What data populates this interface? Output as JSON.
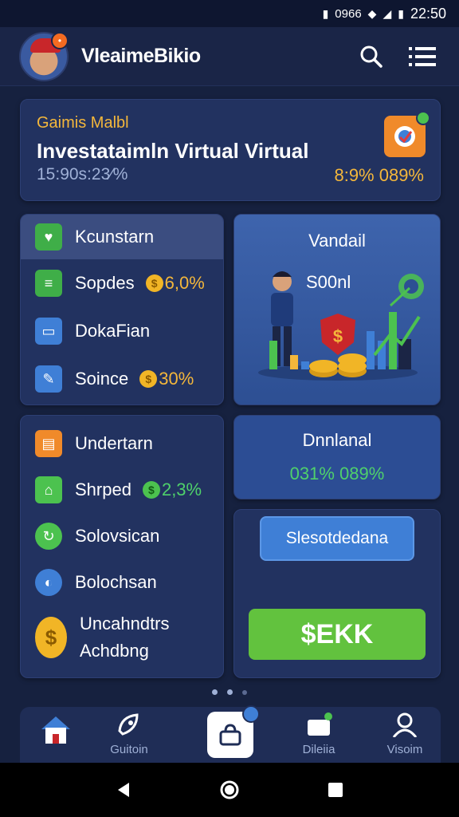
{
  "status_bar": {
    "network": "0966",
    "time": "22:50"
  },
  "header": {
    "title": "VleaimeBikio"
  },
  "hero": {
    "kicker": "Gaimis Malbl",
    "title": "Investataimln Virtual Virtual",
    "sub": "15:90s:23⁄%",
    "pct": "8:9% 089%"
  },
  "list1": {
    "items": [
      {
        "label": "Kcunstarn",
        "value": "",
        "icon": "heart-icon"
      },
      {
        "label": "Sopdes",
        "coin": "$",
        "value": "6,0%",
        "icon": "chart-icon"
      },
      {
        "label": "DokaFian",
        "coin": "",
        "value": "",
        "icon": "card-icon"
      },
      {
        "label": "Soince",
        "coin": "$",
        "value": "30%",
        "icon": "pen-icon"
      }
    ]
  },
  "illustration": {
    "title": "Vandail",
    "subtitle": "S00nl"
  },
  "list2": {
    "items": [
      {
        "label": "Undertarn",
        "icon": "clipboard-icon"
      },
      {
        "label": "Shrped",
        "coin": "$",
        "value": "2,3%",
        "icon": "store-icon"
      },
      {
        "label": "Solovsican",
        "icon": "refresh-icon"
      },
      {
        "label": "Bolochsan",
        "icon": "search-globe-icon"
      },
      {
        "label": "Uncahndtrs",
        "label2": "Achdbng",
        "icon": "dollar-coin-icon"
      }
    ]
  },
  "stat": {
    "title": "Dnnlanal",
    "value": "031% 089%"
  },
  "actions": {
    "blue_label": "Slesotdedana",
    "green_label": "$EKK"
  },
  "bottom_nav": {
    "items": [
      {
        "label": "",
        "icon": "home-icon"
      },
      {
        "label": "Guitoin",
        "icon": "rocket-icon"
      },
      {
        "label": "",
        "icon": "bag-icon"
      },
      {
        "label": "Dileiia",
        "icon": "wallet-icon"
      },
      {
        "label": "Visoim",
        "icon": "profile-icon"
      }
    ]
  },
  "colors": {
    "accent_gold": "#f4b73b",
    "accent_green": "#4fd16b",
    "background": "#16213f"
  }
}
